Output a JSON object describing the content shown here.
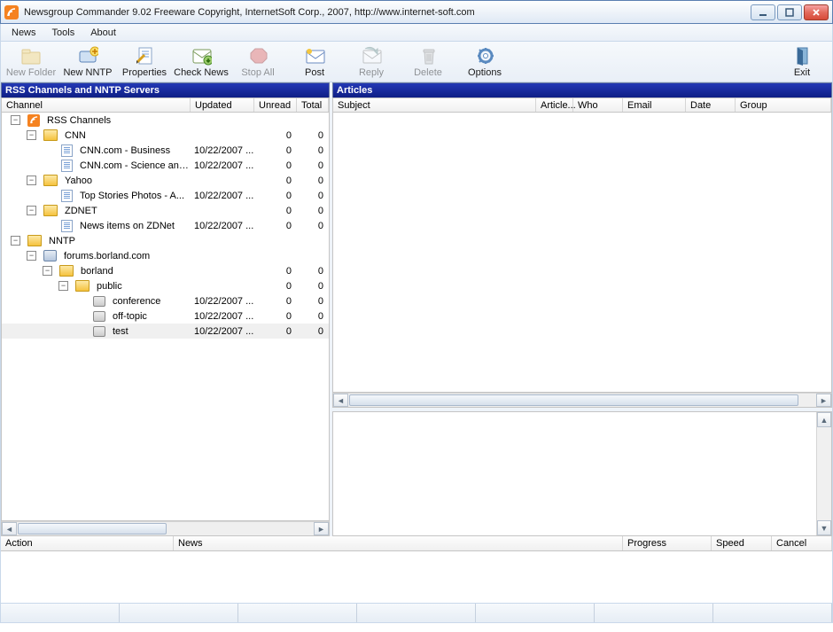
{
  "title": "Newsgroup Commander 9.02  Freeware     Copyright, InternetSoft Corp., 2007, http://www.internet-soft.com",
  "menu": {
    "news": "News",
    "tools": "Tools",
    "about": "About"
  },
  "toolbar": {
    "new_folder": "New Folder",
    "new_nntp": "New NNTP",
    "properties": "Properties",
    "check_news": "Check News",
    "stop_all": "Stop All",
    "post": "Post",
    "reply": "Reply",
    "delete": "Delete",
    "options": "Options",
    "exit": "Exit"
  },
  "panels": {
    "left_title": "RSS Channels and NNTP Servers",
    "right_title": "Articles"
  },
  "left_cols": {
    "channel": "Channel",
    "updated": "Updated",
    "unread": "Unread",
    "total": "Total"
  },
  "right_cols": {
    "subject": "Subject",
    "article": "Article...",
    "who": "Who",
    "email": "Email",
    "date": "Date",
    "group": "Group"
  },
  "task_cols": {
    "action": "Action",
    "news": "News",
    "progress": "Progress",
    "speed": "Speed",
    "cancel": "Cancel"
  },
  "tree": [
    {
      "depth": 0,
      "exp": "-",
      "icon": "feed",
      "label": "RSS Channels",
      "updated": "",
      "unread": "",
      "total": ""
    },
    {
      "depth": 1,
      "exp": "-",
      "icon": "folder",
      "label": "CNN",
      "updated": "",
      "unread": "0",
      "total": "0"
    },
    {
      "depth": 2,
      "exp": "",
      "icon": "page",
      "label": "CNN.com - Business",
      "updated": "10/22/2007 ...",
      "unread": "0",
      "total": "0"
    },
    {
      "depth": 2,
      "exp": "",
      "icon": "page",
      "label": "CNN.com - Science and...",
      "updated": "10/22/2007 ...",
      "unread": "0",
      "total": "0"
    },
    {
      "depth": 1,
      "exp": "-",
      "icon": "folder",
      "label": "Yahoo",
      "updated": "",
      "unread": "0",
      "total": "0"
    },
    {
      "depth": 2,
      "exp": "",
      "icon": "page",
      "label": "Top Stories Photos - A...",
      "updated": "10/22/2007 ...",
      "unread": "0",
      "total": "0"
    },
    {
      "depth": 1,
      "exp": "-",
      "icon": "folder",
      "label": "ZDNET",
      "updated": "",
      "unread": "0",
      "total": "0"
    },
    {
      "depth": 2,
      "exp": "",
      "icon": "page",
      "label": "News items on ZDNet",
      "updated": "10/22/2007 ...",
      "unread": "0",
      "total": "0"
    },
    {
      "depth": 0,
      "exp": "-",
      "icon": "folder",
      "label": "NNTP",
      "updated": "",
      "unread": "",
      "total": ""
    },
    {
      "depth": 1,
      "exp": "-",
      "icon": "server",
      "label": "forums.borland.com",
      "updated": "",
      "unread": "",
      "total": ""
    },
    {
      "depth": 2,
      "exp": "-",
      "icon": "folder",
      "label": "borland",
      "updated": "",
      "unread": "0",
      "total": "0"
    },
    {
      "depth": 3,
      "exp": "-",
      "icon": "folder",
      "label": "public",
      "updated": "",
      "unread": "0",
      "total": "0"
    },
    {
      "depth": 4,
      "exp": "",
      "icon": "news",
      "label": "conference",
      "updated": "10/22/2007 ...",
      "unread": "0",
      "total": "0"
    },
    {
      "depth": 4,
      "exp": "",
      "icon": "news",
      "label": "off-topic",
      "updated": "10/22/2007 ...",
      "unread": "0",
      "total": "0"
    },
    {
      "depth": 4,
      "exp": "",
      "icon": "news",
      "label": "test",
      "updated": "10/22/2007 ...",
      "unread": "0",
      "total": "0",
      "selected": true
    }
  ]
}
